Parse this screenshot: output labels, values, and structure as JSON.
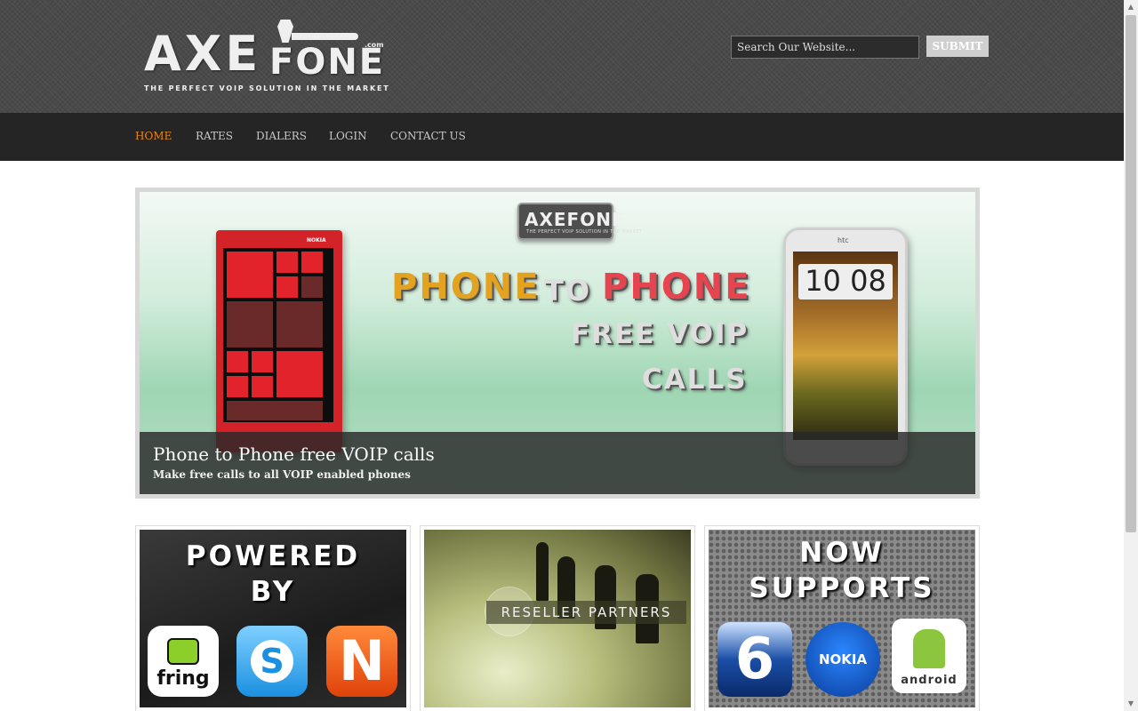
{
  "brand": {
    "logo_main": "AXE",
    "logo_fone": "FONE",
    "logo_com": ".com",
    "tagline": "THE PERFECT VOIP SOLUTION IN THE MARKET"
  },
  "search": {
    "placeholder": "Search Our Website...",
    "submit_label": "SUBMIT"
  },
  "nav": {
    "items": [
      {
        "label": "HOME",
        "active": true
      },
      {
        "label": "RATES",
        "active": false
      },
      {
        "label": "DIALERS",
        "active": false
      },
      {
        "label": "LOGIN",
        "active": false
      },
      {
        "label": "CONTACT US",
        "active": false
      }
    ]
  },
  "banner": {
    "badge_text": "AXEFONE",
    "badge_sub": "THE PERFECT VOIP SOLUTION IN THE MARKET",
    "headline_phone1": "PHONE",
    "headline_to": "TO",
    "headline_phone2": "PHONE",
    "headline_free": "FREE VOIP",
    "headline_calls": "CALLS",
    "nokia_brand": "NOKIA",
    "htc_brand": "htc",
    "htc_clock": "10 08",
    "caption_title": "Phone to Phone free VOIP calls",
    "caption_sub": "Make free calls to all VOIP enabled phones"
  },
  "cards": {
    "powered_heading_1": "POWERED",
    "powered_heading_2": "BY",
    "fring_label": "fring",
    "skype_label": "S",
    "n_label": "N",
    "reseller_label": "RESELLER PARTNERS",
    "supports_heading_1": "NOW",
    "supports_heading_2": "SUPPORTS",
    "ios_label": "6",
    "nokia_label": "NOKIA",
    "android_label": "android"
  },
  "colors": {
    "accent": "#e8851c",
    "nav_bg": "#252525",
    "header_bg": "#4a4a4a"
  }
}
